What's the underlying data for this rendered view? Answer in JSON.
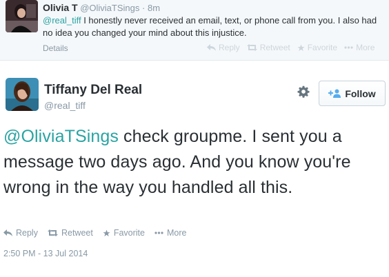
{
  "reply_tweet": {
    "name": "Olivia T",
    "handle": "@OliviaTSings",
    "separator": "·",
    "time": "8m",
    "mention": "@real_tiff",
    "text": " I honestly never received an email, text, or phone call from you. I also had no idea you changed your mind about this injustice.",
    "details_label": "Details",
    "actions": {
      "reply": "Reply",
      "retweet": "Retweet",
      "favorite": "Favorite",
      "more": "More"
    }
  },
  "main_tweet": {
    "name": "Tiffany Del Real",
    "handle": "@real_tiff",
    "follow_label": "Follow",
    "mention": "@OliviaTSings",
    "text": " check groupme. I sent you a message two days ago. And you know you're wrong in the way you handled all this.",
    "actions": {
      "reply": "Reply",
      "retweet": "Retweet",
      "favorite": "Favorite",
      "more": "More"
    },
    "timestamp": "2:50 PM - 13 Jul 2014"
  },
  "colors": {
    "link": "#2aa3a3",
    "muted": "#8899a6",
    "faint": "#ccd6dd",
    "text": "#292f33"
  },
  "icons": [
    "reply-icon",
    "retweet-icon",
    "star-icon",
    "more-dots-icon",
    "gear-icon",
    "add-user-icon"
  ]
}
